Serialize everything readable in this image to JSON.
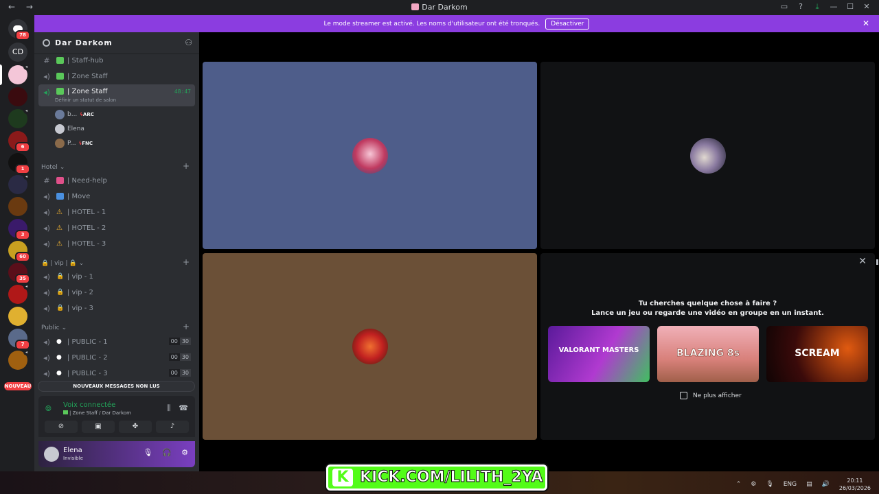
{
  "window": {
    "title": "Dar Darkom",
    "nav": "← →"
  },
  "banner": {
    "text": "Le mode streamer est activé. Les noms d'utilisateur ont été tronqués.",
    "button": "Désactiver"
  },
  "servers": {
    "home_badge": "78",
    "cd_label": "CD",
    "badges": [
      "6",
      "1",
      "3",
      "60",
      "35",
      "7"
    ],
    "nouveau": "NOUVEAU"
  },
  "guild": {
    "name": "Dar Darkom"
  },
  "channels": {
    "staff_hub": "| Staff-hub",
    "zone_staff_1": "| Zone Staff",
    "zone_staff_active": "| Zone Staff",
    "zone_staff_timer": "48:47",
    "zone_staff_status": "Définir un statut de salon",
    "users": [
      {
        "name": "b...",
        "tag": "ARC"
      },
      {
        "name": "Elena",
        "tag": ""
      },
      {
        "name": "P...",
        "tag": "FNC"
      }
    ],
    "cat_hotel": "Hotel",
    "need_help": "| Need-help",
    "move": "| Move",
    "hotel1": "| HOTEL - 1",
    "hotel2": "| HOTEL - 2",
    "hotel3": "| HOTEL - 3",
    "cat_vip": "| vip |",
    "vip1": "| vip - 1",
    "vip2": "| vip - 2",
    "vip3": "| vip - 3",
    "cat_public": "Public",
    "public1": "| PUBLIC - 1",
    "public2": "| PUBLIC - 2",
    "public3": "| PUBLIC - 3",
    "count_a": "00",
    "count_b": "30",
    "new_messages": "NOUVEAUX MESSAGES NON LUS"
  },
  "voice": {
    "status": "Voix connectée",
    "location": "| Zone Staff / Dar Darkom"
  },
  "user": {
    "name": "Elena",
    "status": "Invisible"
  },
  "activity": {
    "line1": "Tu cherches quelque chose à faire ?",
    "line2": "Lance un jeu ou regarde une vidéo en groupe en un instant.",
    "cards": [
      "VALORANT MASTERS",
      "BLAZING 8s",
      "SCREAM"
    ],
    "dont_show": "Ne plus afficher"
  },
  "overlay": {
    "kick": "KICK.COM/LILITH_2YA"
  },
  "taskbar": {
    "lang": "ENG",
    "time": "20:11",
    "date": "26/03/2026"
  },
  "colors": {
    "accent": "#8b3de0",
    "green": "#23a55a",
    "red": "#f23f43",
    "tile_blue": "#4e5d8a",
    "tile_brown": "#6b5037"
  }
}
